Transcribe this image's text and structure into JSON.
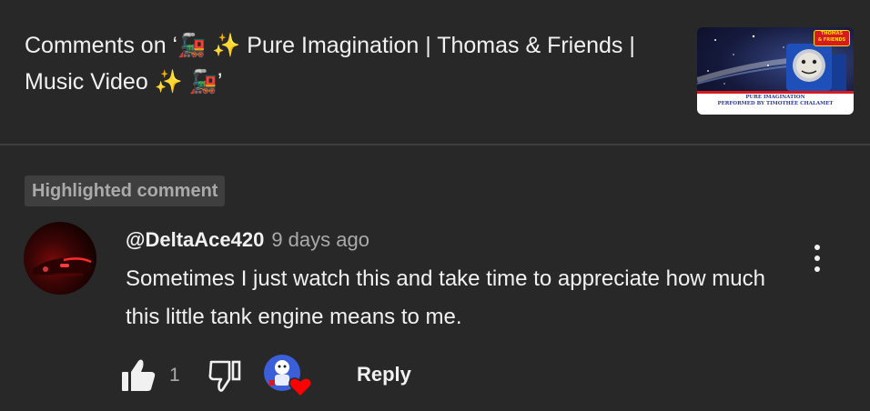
{
  "header": {
    "title": "Comments on ‘🚂 ✨ Pure Imagination | Thomas & Friends | Music Video ✨ 🚂’",
    "thumbnail": {
      "logo_line1": "THOMAS",
      "logo_line2": "& FRIENDS",
      "banner_line1": "PURE IMAGINATION",
      "banner_line2": "PERFORMED BY TIMOTHÉE CHALAMET"
    }
  },
  "badge": {
    "label": "Highlighted comment"
  },
  "comment": {
    "author": "@DeltaAce420",
    "time": "9 days ago",
    "text": "Sometimes I just watch this and take time to appreciate how much this little tank engine means to me.",
    "like_count": "1",
    "reply_label": "Reply",
    "icons": {
      "menu": "more-vert-icon",
      "like": "thumbs-up-filled-icon",
      "dislike": "thumbs-down-outline-icon",
      "creator_heart": "creator-heart-icon"
    }
  },
  "colors": {
    "background": "#282828",
    "text": "#f1f1f1",
    "secondary_text": "#aaaaaa",
    "badge_bg": "#3f3f3f",
    "heart": "#ff0000"
  }
}
